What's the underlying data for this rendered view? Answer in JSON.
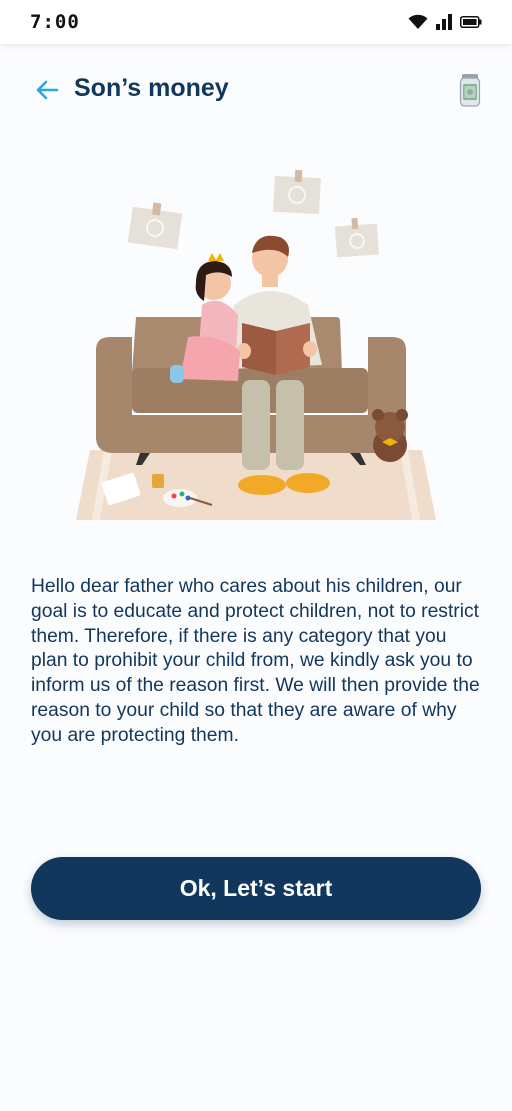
{
  "status_bar": {
    "time": "7:00",
    "icons": [
      "wifi-icon",
      "signal-icon",
      "battery-icon"
    ]
  },
  "header": {
    "title": "Son’s money",
    "back_icon": "arrow-left-icon",
    "action_icon": "money-jar-icon"
  },
  "illustration": {
    "description_icon": "father-reading-to-daughter-illustration"
  },
  "main": {
    "message": "Hello dear father who cares about his children, our goal is to educate and protect children, not to restrict them. Therefore, if there is any category that you plan to prohibit your child from, we kindly ask you to inform us of the reason first. We will then provide the reason to your child so that they are aware of why you are protecting them."
  },
  "actions": {
    "start_label": "Ok, Let’s start"
  },
  "colors": {
    "primary": "#12375c",
    "accent": "#29a7e0",
    "background": "#fbfcfe"
  }
}
